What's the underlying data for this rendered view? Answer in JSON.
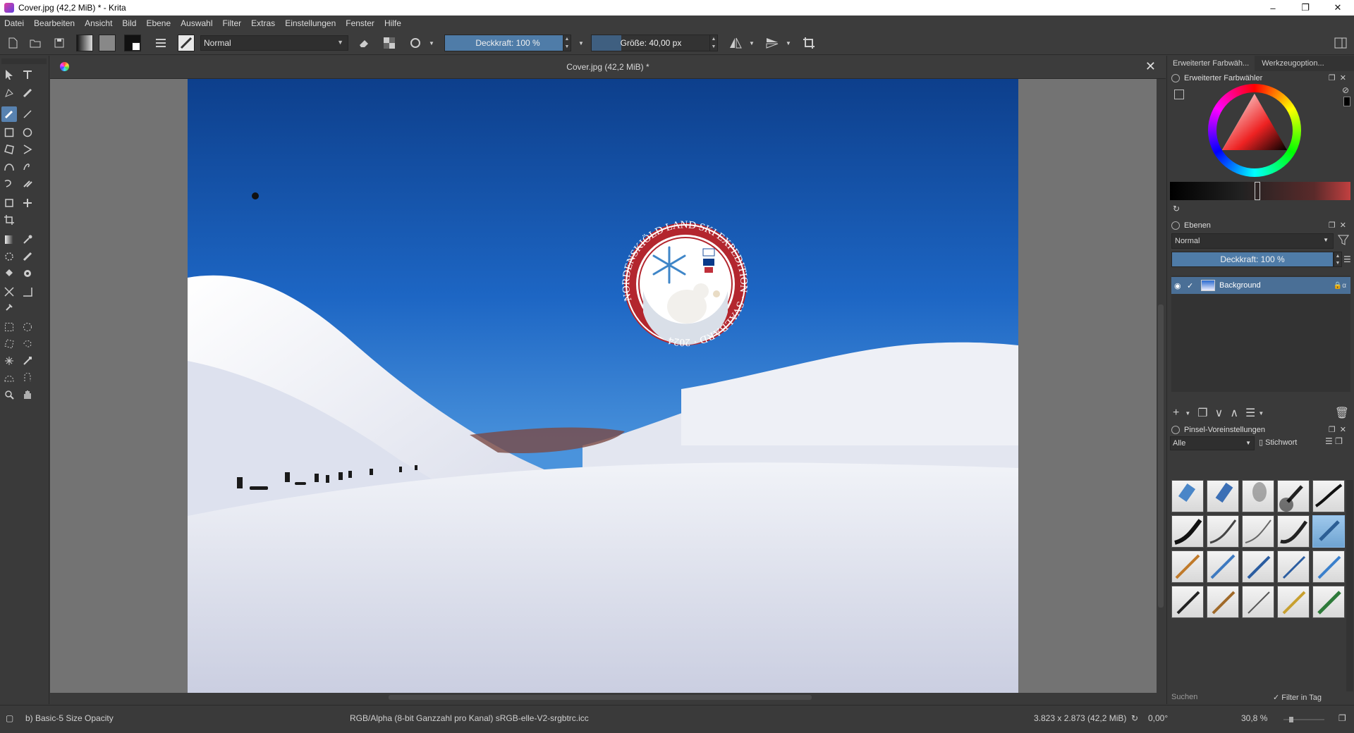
{
  "window": {
    "title": "Cover.jpg (42,2 MiB) * - Krita"
  },
  "menu": [
    "Datei",
    "Bearbeiten",
    "Ansicht",
    "Bild",
    "Ebene",
    "Auswahl",
    "Filter",
    "Extras",
    "Einstellungen",
    "Fenster",
    "Hilfe"
  ],
  "toolbar": {
    "blend_mode": "Normal",
    "opacity_label": "Deckkraft: 100 %",
    "opacity_fraction": 1.0,
    "size_label": "Größe: 40,00 px"
  },
  "document": {
    "tab_title": "Cover.jpg (42,2 MiB) *",
    "badge": {
      "arc_text": "NORDENSKIÖLD LAND SKI EXPEDITION · SVALBARD · 2024"
    }
  },
  "dock": {
    "tabs": [
      "Erweiterter Farbwäh...",
      "Werkzeugoption..."
    ],
    "color_panel_title": "Erweiterter Farbwähler",
    "layers_panel_title": "Ebenen",
    "layers_blend": "Normal",
    "layers_opacity": "Deckkraft:  100 %",
    "layers": [
      {
        "name": "Background",
        "visible": true
      }
    ],
    "brush_panel_title": "Pinsel-Voreinstellungen",
    "brush_filter": "Alle",
    "brush_tag": "Stichwort",
    "search_placeholder": "Suchen",
    "filter_in_tag": "Filter in Tag"
  },
  "status": {
    "brush": "b) Basic-5 Size Opacity",
    "color_space": "RGB/Alpha (8-bit Ganzzahl pro Kanal)  sRGB-elle-V2-srgbtrc.icc",
    "dimensions": "3.823 x 2.873 (42,2 MiB)",
    "rotation": "0,00°",
    "zoom": "30,8 %"
  },
  "colors": {
    "accent": "#4f7ca8",
    "badge_red": "#b3262e",
    "sky_top": "#0d3f8c"
  }
}
